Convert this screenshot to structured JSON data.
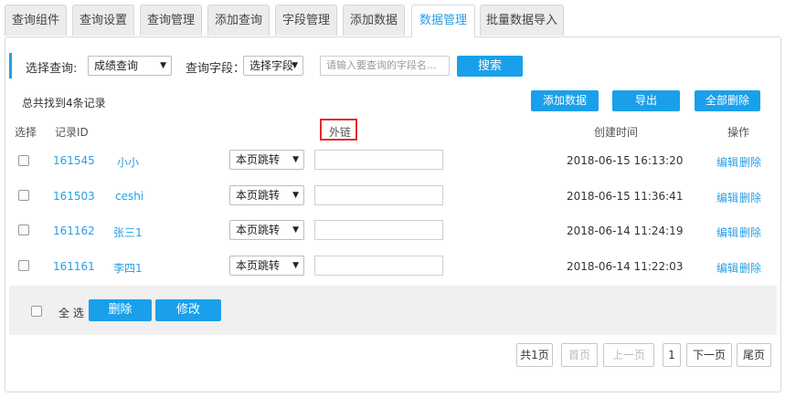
{
  "tabs": [
    {
      "label": "查询组件"
    },
    {
      "label": "查询设置"
    },
    {
      "label": "查询管理"
    },
    {
      "label": "添加查询"
    },
    {
      "label": "字段管理"
    },
    {
      "label": "添加数据"
    },
    {
      "label": "数据管理"
    },
    {
      "label": "批量数据导入"
    }
  ],
  "search": {
    "select_query_label": "选择查询:",
    "select_query_value": "成绩查询",
    "field_label": "查询字段：",
    "field_value": "选择字段",
    "placeholder": "请输入要查询的字段名...",
    "search_button": "搜索"
  },
  "summary": "总共找到4条记录",
  "actions": {
    "add": "添加数据",
    "export": "导出",
    "delete_all": "全部删除"
  },
  "headers": {
    "select": "选择",
    "record_id": "记录ID",
    "external_link": "外链",
    "created": "创建时间",
    "ops": "操作"
  },
  "rows": [
    {
      "id": "161545",
      "name": "小小",
      "jump": "本页跳转",
      "time": "2018-06-15 16:13:20",
      "edit": "编辑",
      "delete": "删除"
    },
    {
      "id": "161503",
      "name": "ceshi",
      "jump": "本页跳转",
      "time": "2018-06-15 11:36:41",
      "edit": "编辑",
      "delete": "删除"
    },
    {
      "id": "161162",
      "name": "张三1",
      "jump": "本页跳转",
      "time": "2018-06-14 11:24:19",
      "edit": "编辑",
      "delete": "删除"
    },
    {
      "id": "161161",
      "name": "李四1",
      "jump": "本页跳转",
      "time": "2018-06-14 11:22:03",
      "edit": "编辑",
      "delete": "删除"
    }
  ],
  "bottom": {
    "select_all": "全 选",
    "delete": "删除",
    "modify": "修改"
  },
  "pager": {
    "total": "共1页",
    "first": "首页",
    "prev": "上一页",
    "current": "1",
    "next": "下一页",
    "last": "尾页"
  },
  "colors": {
    "accent": "#1aa0ea",
    "active_tab_text": "#2a9ee3",
    "highlight": "#e52a2a"
  }
}
